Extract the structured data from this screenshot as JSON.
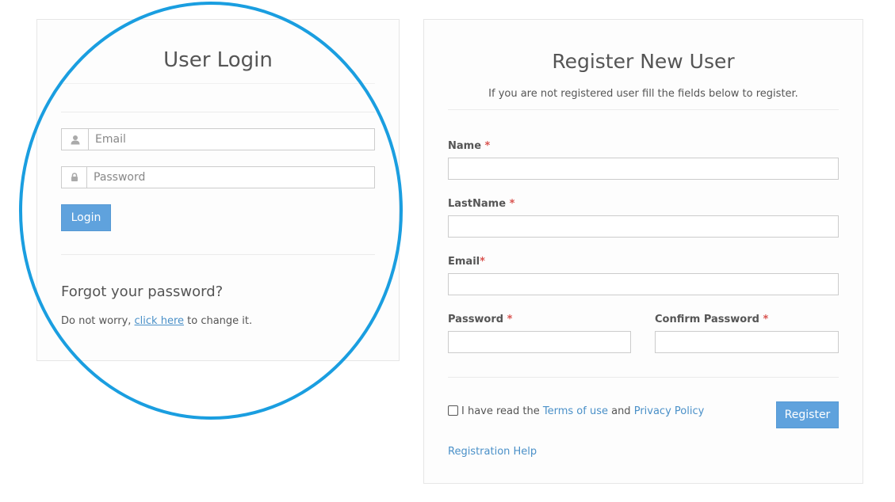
{
  "login": {
    "title": "User Login",
    "email_placeholder": "Email",
    "password_placeholder": "Password",
    "login_button": "Login",
    "forgot_title": "Forgot your password?",
    "forgot_text_prefix": "Do not worry, ",
    "forgot_link": "click here",
    "forgot_text_suffix": " to change it.",
    "user_icon": "user-icon",
    "lock_icon": "lock-icon"
  },
  "register": {
    "title": "Register New User",
    "subtitle": "If you are not registered user fill the fields below to register.",
    "fields": {
      "name_label": "Name",
      "lastname_label": "LastName",
      "email_label": "Email",
      "password_label": "Password",
      "confirm_password_label": "Confirm Password",
      "required_marker": "*"
    },
    "terms": {
      "prefix": "I have read the ",
      "terms_link": "Terms of use",
      "middle": " and ",
      "privacy_link": "Privacy Policy"
    },
    "register_button": "Register",
    "help_link": "Registration Help"
  },
  "colors": {
    "accent": "#5fa2dd",
    "link": "#4a90c8",
    "required": "#d9534f",
    "highlight_circle": "#1a9ee0"
  }
}
